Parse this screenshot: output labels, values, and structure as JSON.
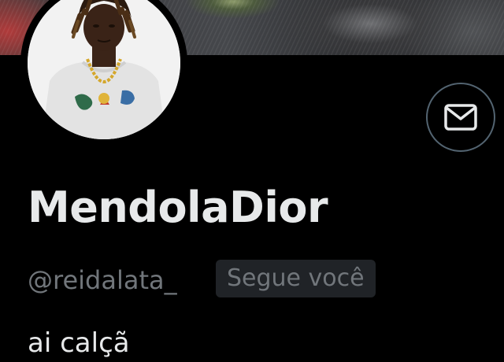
{
  "profile": {
    "display_name": "MendolaDior",
    "handle": "@reidalata_",
    "follows_you_badge": "Segue você",
    "bio_partial": "ai calçã"
  },
  "icons": {
    "dm_button": "envelope-icon"
  },
  "colors": {
    "background": "#000000",
    "primary_text": "#e7e9ea",
    "secondary_text": "#71767b",
    "badge_background": "#202327",
    "button_border": "#536471"
  }
}
